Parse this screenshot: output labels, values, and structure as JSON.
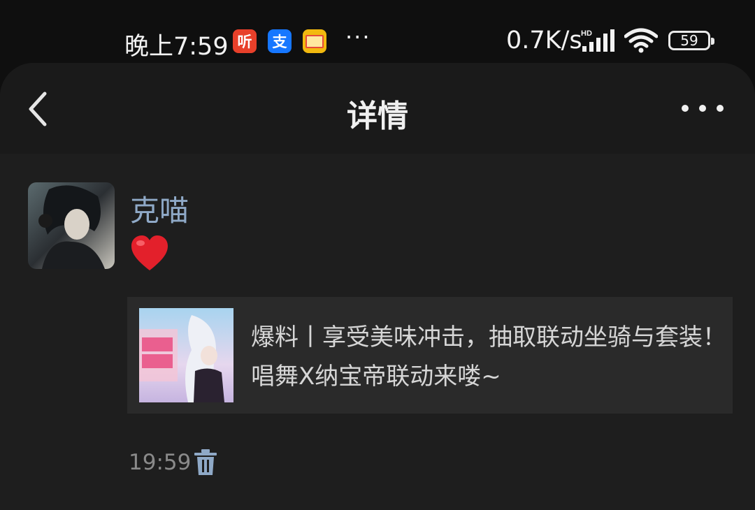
{
  "status_bar": {
    "time": "晚上7:59",
    "apps": [
      {
        "icon": "listen-app-icon",
        "glyph": "听",
        "color": "#e8402a"
      },
      {
        "icon": "alipay-app-icon",
        "glyph": "支",
        "color": "#1677ff"
      },
      {
        "icon": "mail-app-icon",
        "glyph": "",
        "color": "#f2b90f"
      }
    ],
    "more": "···",
    "net_speed": "0.7K/s",
    "hd_label": "HD",
    "battery": "59"
  },
  "header": {
    "title": "详情"
  },
  "post": {
    "username": "克喵",
    "reaction": "heart",
    "card_text": "爆料丨享受美味冲击，抽取联动坐骑与套装！唱舞X纳宝帝联动来喽~",
    "timestamp": "19:59"
  },
  "colors": {
    "username": "#8fa9c7",
    "card_bg": "#2a2a2a",
    "page_bg": "#1e1e1e",
    "heart": "#e3202b"
  }
}
